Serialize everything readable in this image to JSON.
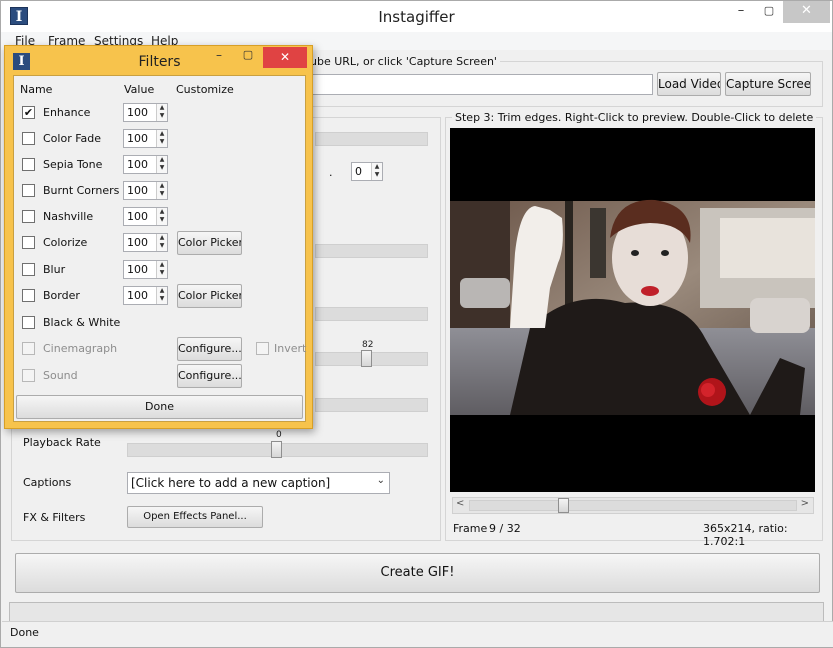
{
  "window": {
    "title": "Instagiffer",
    "app_icon_glyph": "I",
    "minimize_glyph": "–",
    "maximize_glyph": "▢",
    "close_glyph": "✕"
  },
  "menu": [
    "File",
    "Frame",
    "Settings",
    "Help"
  ],
  "step1": {
    "label_partial": "ube URL, or click 'Capture Screen'",
    "url_value": "",
    "load_button": "Load Video",
    "capture_button": "Capture Screen"
  },
  "step2": {
    "hidden_spin_dot": ".",
    "hidden_spin_value": "0",
    "slider_value_82": "82",
    "playback_rate_label": "Playback Rate",
    "playback_rate_value": "0",
    "captions_label": "Captions",
    "captions_selected": "[Click here to add a new caption]",
    "fx_label": "FX & Filters",
    "fx_button": "Open Effects Panel..."
  },
  "step3": {
    "label": "Step 3: Trim edges. Right-Click to preview. Double-Click to delete",
    "frame_label": "Frame",
    "frame_value": "9 / 32",
    "dimensions": "365x214, ratio: 1.702:1",
    "scroll_left_glyph": "<",
    "scroll_right_glyph": ">",
    "scroll_position_fraction": 0.28
  },
  "create_button": "Create GIF!",
  "status_text": "Done",
  "filters_dialog": {
    "title": "Filters",
    "icon_glyph": "I",
    "minimize_glyph": "–",
    "maximize_glyph": "▢",
    "close_glyph": "✕",
    "headers": {
      "name": "Name",
      "value": "Value",
      "customize": "Customize"
    },
    "filters": [
      {
        "name": "Enhance",
        "checked": true,
        "value": "100",
        "customize": "",
        "enabled": true
      },
      {
        "name": "Color Fade",
        "checked": false,
        "value": "100",
        "customize": "",
        "enabled": true
      },
      {
        "name": "Sepia Tone",
        "checked": false,
        "value": "100",
        "customize": "",
        "enabled": true
      },
      {
        "name": "Burnt Corners",
        "checked": false,
        "value": "100",
        "customize": "",
        "enabled": true
      },
      {
        "name": "Nashville",
        "checked": false,
        "value": "100",
        "customize": "",
        "enabled": true
      },
      {
        "name": "Colorize",
        "checked": false,
        "value": "100",
        "customize": "Color Picker",
        "enabled": true
      },
      {
        "name": "Blur",
        "checked": false,
        "value": "100",
        "customize": "",
        "enabled": true
      },
      {
        "name": "Border",
        "checked": false,
        "value": "100",
        "customize": "Color Picker",
        "enabled": true
      },
      {
        "name": "Black & White",
        "checked": false,
        "value": "",
        "customize": "",
        "enabled": true
      },
      {
        "name": "Cinemagraph",
        "checked": false,
        "value": "",
        "customize": "Configure...",
        "enabled": false,
        "extra": "Invert"
      },
      {
        "name": "Sound",
        "checked": false,
        "value": "",
        "customize": "Configure...",
        "enabled": false
      }
    ],
    "done_button": "Done"
  },
  "colors": {
    "dialog_frame": "#f7c34c",
    "close_button": "#e04343"
  }
}
